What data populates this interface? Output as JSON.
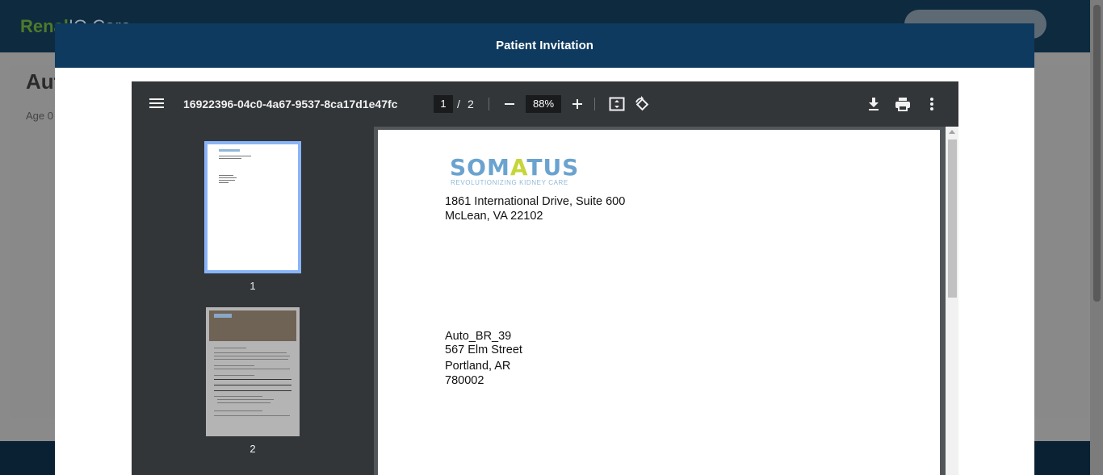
{
  "background": {
    "logo_primary": "Renal",
    "logo_secondary": "IQ Care",
    "page_title": "Aut",
    "page_sub": "Age 0"
  },
  "modal": {
    "title": "Patient Invitation"
  },
  "pdf": {
    "filename": "16922396-04c0-4a67-9537-8ca17d1e47fc",
    "current_page": "1",
    "page_separator": "/",
    "total_pages": "2",
    "zoom": "88%",
    "thumbnails": [
      {
        "label": "1"
      },
      {
        "label": "2"
      }
    ]
  },
  "document": {
    "logo_text_left": "SOM",
    "logo_text_mid": "A",
    "logo_text_right": "TUS",
    "logo_tagline": "REVOLUTIONIZING KIDNEY CARE",
    "sender": {
      "line1": "1861 International Drive, Suite 600",
      "line2": "McLean, VA 22102"
    },
    "recipient": {
      "name": "Auto_BR_39",
      "street": "567 Elm Street",
      "city": "Portland, AR",
      "zip": "780002"
    }
  },
  "colors": {
    "modal_header": "#0d3a5e",
    "toolbar": "#323639",
    "thumb_selected": "#8ab4f8",
    "logo_blue": "#6aa3cf",
    "logo_green": "#c6d63a"
  }
}
